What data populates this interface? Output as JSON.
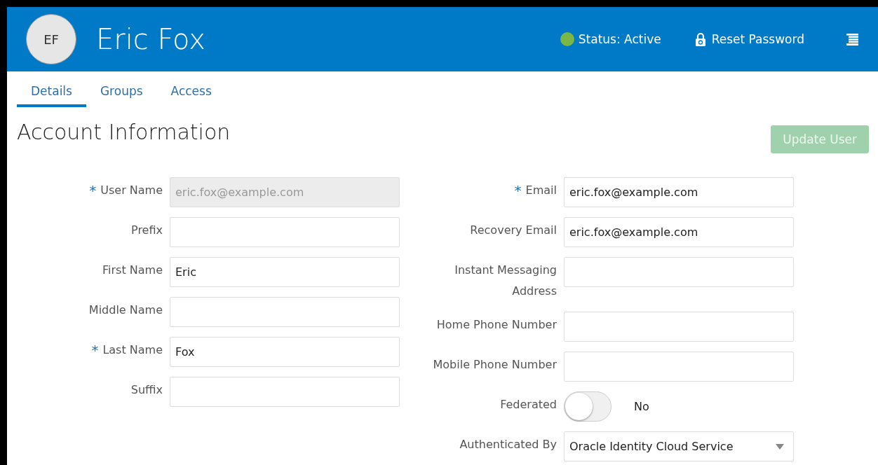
{
  "header": {
    "initials": "EF",
    "name": "Eric Fox",
    "status": {
      "label": "Status: Active",
      "color": "#7ab648"
    },
    "reset_password": "Reset Password"
  },
  "tabs": [
    {
      "label": "Details",
      "selected": true
    },
    {
      "label": "Groups",
      "selected": false
    },
    {
      "label": "Access",
      "selected": false
    }
  ],
  "section": {
    "title": "Account Information",
    "update_button": {
      "label": "Update User",
      "disabled": true
    }
  },
  "left_fields": [
    {
      "kind": "text",
      "asterisk": "*",
      "label": "User Name",
      "value": "eric.fox@example.com",
      "disabled": true
    },
    {
      "kind": "text",
      "label": "Prefix",
      "disabled": false
    },
    {
      "kind": "text",
      "label": "First Name",
      "value": "Eric",
      "disabled": false
    },
    {
      "kind": "text",
      "label": "Middle Name",
      "disabled": false
    },
    {
      "kind": "text",
      "asterisk": "*",
      "label": "Last Name",
      "value": "Fox",
      "disabled": false
    },
    {
      "kind": "text",
      "label": "Suffix",
      "disabled": false
    }
  ],
  "right_fields": [
    {
      "kind": "text",
      "asterisk": "*",
      "label": "Email",
      "value": "eric.fox@example.com",
      "disabled": false
    },
    {
      "kind": "text",
      "label": "Recovery Email",
      "value": "eric.fox@example.com",
      "disabled": false
    },
    {
      "kind": "text",
      "label": "Instant Messaging Address",
      "disabled": false
    },
    {
      "kind": "text",
      "label": "Home Phone Number",
      "disabled": false
    },
    {
      "kind": "text",
      "label": "Mobile Phone Number",
      "disabled": false
    },
    {
      "kind": "toggle",
      "label": "Federated",
      "on": false,
      "value": "No"
    },
    {
      "kind": "select",
      "label": "Authenticated By",
      "value": "Oracle Identity Cloud Service"
    }
  ]
}
